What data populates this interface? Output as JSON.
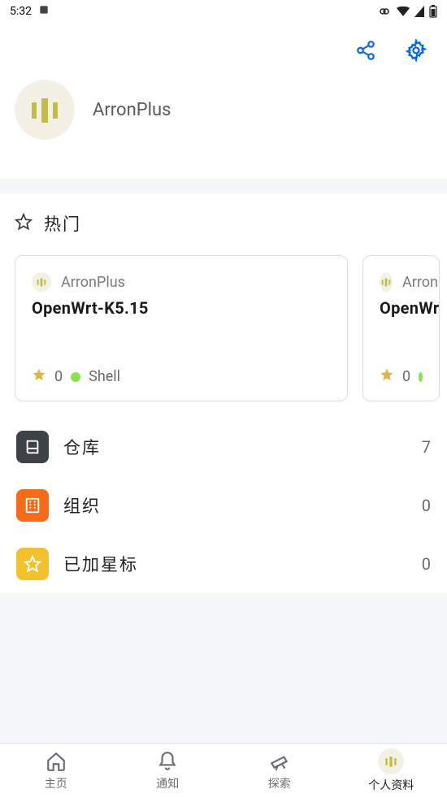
{
  "status": {
    "time": "5:32"
  },
  "profile": {
    "username": "ArronPlus"
  },
  "popular": {
    "title": "热门",
    "cards": [
      {
        "owner": "ArronPlus",
        "name": "OpenWrt-K5.15",
        "stars": "0",
        "language": "Shell"
      },
      {
        "owner": "ArronPlus",
        "name": "OpenWr",
        "stars": "0",
        "language": ""
      }
    ]
  },
  "menu": {
    "repos": {
      "label": "仓库",
      "count": "7"
    },
    "orgs": {
      "label": "组织",
      "count": "0"
    },
    "starred": {
      "label": "已加星标",
      "count": "0"
    }
  },
  "tabs": {
    "home": "主页",
    "notifications": "通知",
    "explore": "探索",
    "profile": "个人资料"
  }
}
